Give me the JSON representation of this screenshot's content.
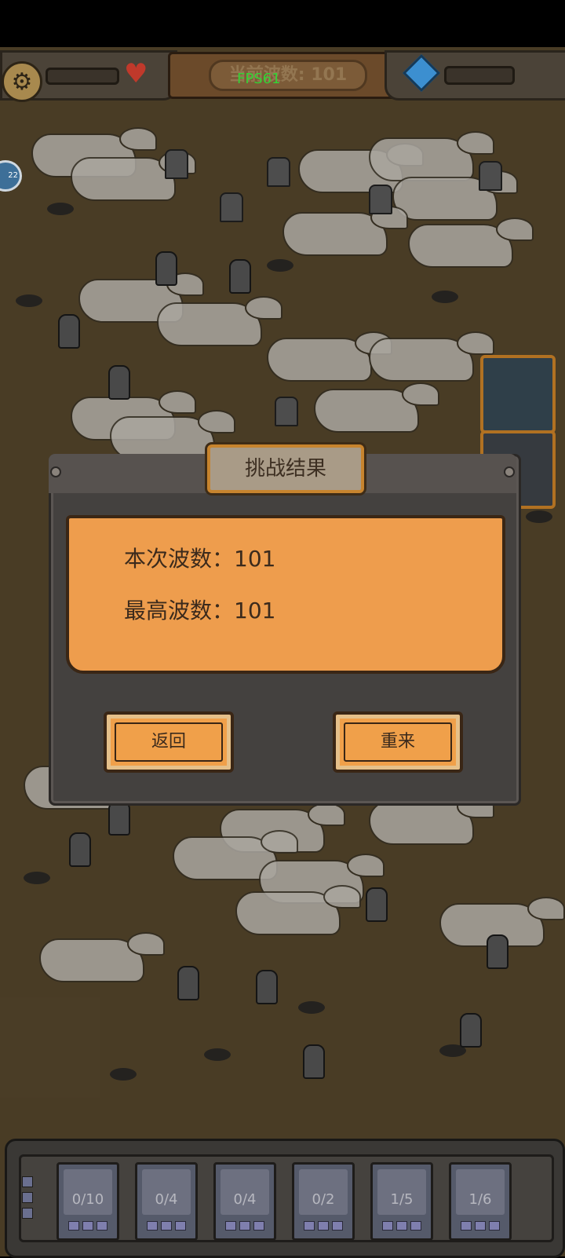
{
  "hud": {
    "wave_banner": "当前波数: 101",
    "fps": "FPS61",
    "side_badge": "22"
  },
  "dialog": {
    "title": "挑战结果",
    "current_wave_label": "本次波数：101",
    "best_wave_label": "最高波数：101",
    "back_label": "返回",
    "retry_label": "重来"
  },
  "units": [
    {
      "count": "0/10"
    },
    {
      "count": "0/4"
    },
    {
      "count": "0/4"
    },
    {
      "count": "0/2"
    },
    {
      "count": "1/5"
    },
    {
      "count": "1/6"
    }
  ],
  "colors": {
    "ground": "#5a4a2e",
    "panel": "#ee9d4d",
    "button": "#f0a04a",
    "frame": "#c7842e",
    "fps": "#35d235"
  }
}
